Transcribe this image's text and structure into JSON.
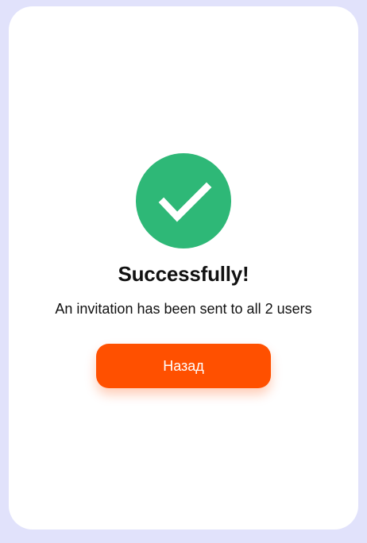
{
  "dialog": {
    "title": "Successfully!",
    "message": "An invitation has been sent to all 2 users",
    "button_label": "Назад",
    "icon": "check-icon"
  },
  "colors": {
    "background": "#e1e2fb",
    "card": "#ffffff",
    "success": "#2eb877",
    "accent": "#ff5000"
  }
}
